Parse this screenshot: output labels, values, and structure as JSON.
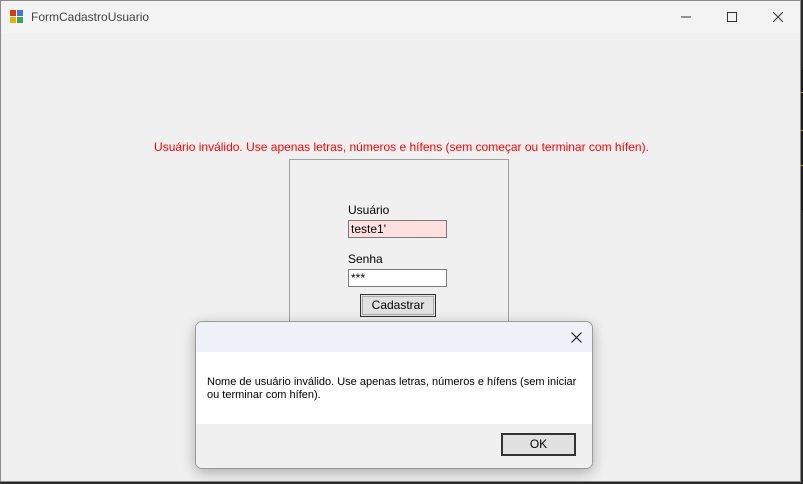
{
  "window": {
    "title": "FormCadastroUsuario"
  },
  "form": {
    "error_message": "Usuário inválido. Use apenas letras, números e hífens (sem começar ou terminar com hífen).",
    "username_label": "Usuário",
    "username_value": "teste1'",
    "password_label": "Senha",
    "password_value": "***",
    "submit_label": "Cadastrar"
  },
  "dialog": {
    "message": "Nome de usuário inválido. Use apenas letras, números e hífens (sem iniciar ou terminar com hífen).",
    "ok_label": "OK"
  },
  "colors": {
    "error_text": "#ff0000",
    "invalid_field_bg": "#ffe0e0"
  }
}
